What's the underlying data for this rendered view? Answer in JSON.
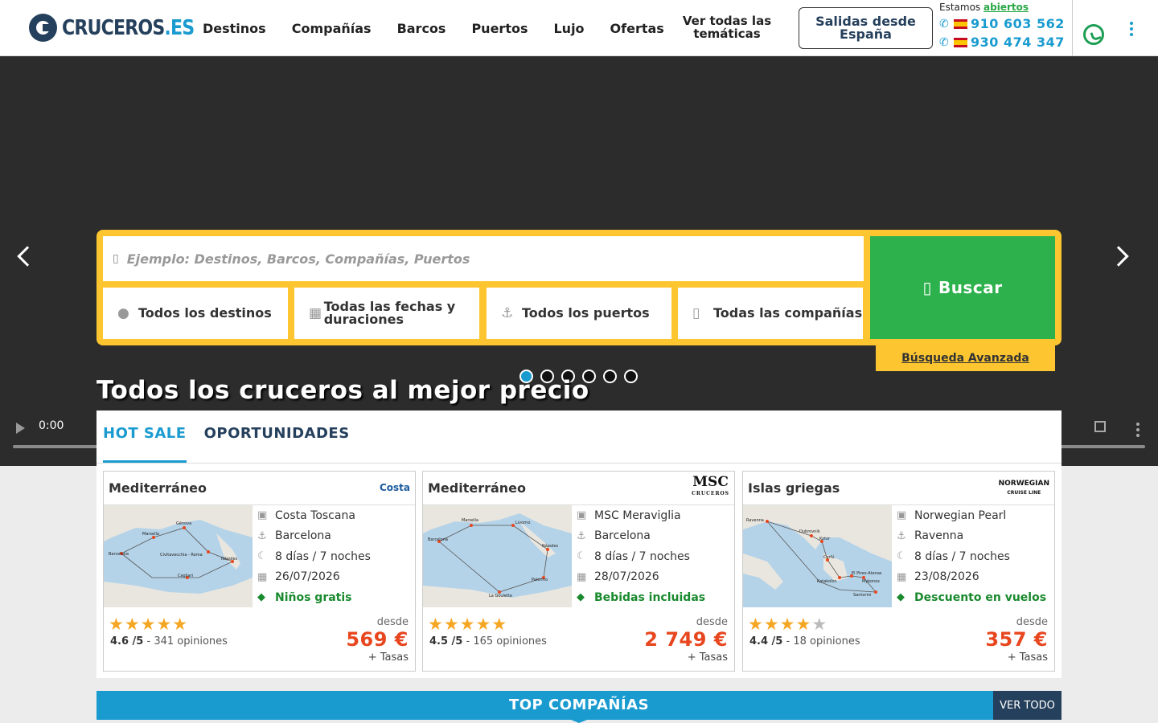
{
  "header": {
    "logo_main": "CRUCEROS",
    "logo_ext": ".ES",
    "nav": [
      "Destinos",
      "Compañías",
      "Barcos",
      "Puertos",
      "Lujo",
      "Ofertas"
    ],
    "nav_tematicas": "Ver todas las temáticas",
    "salidas_button": "Salidas desde España",
    "open_prefix": "Estamos",
    "open_status": "abiertos",
    "phone1": "910 603 562",
    "phone2": "930 474 347"
  },
  "search": {
    "placeholder": "Ejemplo: Destinos, Barcos, Compañías, Puertos",
    "filters": [
      "Todos los destinos",
      "Todas las fechas y duraciones",
      "Todos los puertos",
      "Todas las compañías"
    ],
    "button": "Buscar",
    "advanced": "Búsqueda Avanzada"
  },
  "hero": {
    "title": "Todos los cruceros al mejor precio",
    "video_time": "0:00",
    "slides": 6,
    "active_slide": 1
  },
  "tabs": [
    "HOT SALE",
    "OPORTUNIDADES"
  ],
  "cards": [
    {
      "title": "Mediterráneo",
      "brand": "Costa",
      "ship": "Costa Toscana",
      "port": "Barcelona",
      "duration": "8 días / 7 noches",
      "date": "26/07/2026",
      "promo": "Niños gratis",
      "stars": 5,
      "rating_score": "4.6 /5",
      "rating_count": "341 opiniones",
      "desde": "desde",
      "price": "569 €",
      "tasas": "+ Tasas",
      "map_labels": [
        "Marsella",
        "Génova",
        "Barcelona",
        "Civitavecchia - Roma",
        "Nápoles",
        "Cagliari"
      ]
    },
    {
      "title": "Mediterráneo",
      "brand": "MSC",
      "brand_sub": "CRUCEROS",
      "ship": "MSC Meraviglia",
      "port": "Barcelona",
      "duration": "8 días / 7 noches",
      "date": "28/07/2026",
      "promo": "Bebidas incluidas",
      "stars": 5,
      "rating_score": "4.5 /5",
      "rating_count": "165 opiniones",
      "desde": "desde",
      "price": "2 749 €",
      "tasas": "+ Tasas",
      "map_labels": [
        "Marsella",
        "Livorno",
        "Barcelona",
        "Nápoles",
        "Palermo",
        "La Goulette"
      ]
    },
    {
      "title": "Islas griegas",
      "brand": "NORWEGIAN",
      "brand_sub": "CRUISE LINE",
      "ship": "Norwegian Pearl",
      "port": "Ravenna",
      "duration": "8 días / 7 noches",
      "date": "23/08/2026",
      "promo": "Descuento en vuelos",
      "stars": 4,
      "rating_score": "4.4 /5",
      "rating_count": "18 opiniones",
      "desde": "desde",
      "price": "357 €",
      "tasas": "+ Tasas",
      "map_labels": [
        "Ravenna",
        "Dubrovnik",
        "Kotor",
        "Corfú",
        "Katakolon",
        "El Pireo-Atenas",
        "Mykonos",
        "Santorini"
      ]
    }
  ],
  "top_companias": {
    "title": "TOP COMPAÑÍAS",
    "ver_todo": "VER TODO"
  },
  "colors": {
    "brand_blue": "#1a9bd0",
    "navy": "#25405c",
    "yellow": "#fdc630",
    "green": "#2db14c",
    "price_red": "#e8461e"
  }
}
